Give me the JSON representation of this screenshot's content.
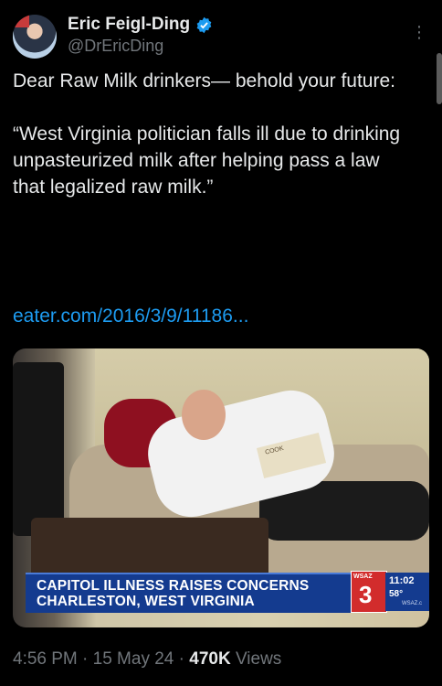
{
  "author": {
    "name": "Eric Feigl-Ding",
    "handle": "@DrEricDing"
  },
  "more_icon": "⋮",
  "tweet": {
    "text": "Dear Raw Milk drinkers— behold your future:\n\n“West Virginia politician falls ill due to drinking unpasteurized milk after helping pass a law that legalized raw milk.”",
    "link": "eater.com/2016/3/9/11186..."
  },
  "media": {
    "banner_line1": "CAPITOL ILLNESS RAISES CONCERNS",
    "banner_line2": "CHARLESTON, WEST VIRGINIA",
    "station_label": "WSAZ",
    "channel_number": "3",
    "time": "11:02",
    "temp": "58°",
    "site": "WSAZ.c",
    "book_label": "COOK"
  },
  "footer": {
    "timestamp": "4:56 PM · 15 May 24 · ",
    "views_count": "470K",
    "views_label": " Views"
  },
  "colors": {
    "background": "#000000",
    "link": "#1d9bf0",
    "muted": "#71767b",
    "verified": "#1d9bf0"
  }
}
